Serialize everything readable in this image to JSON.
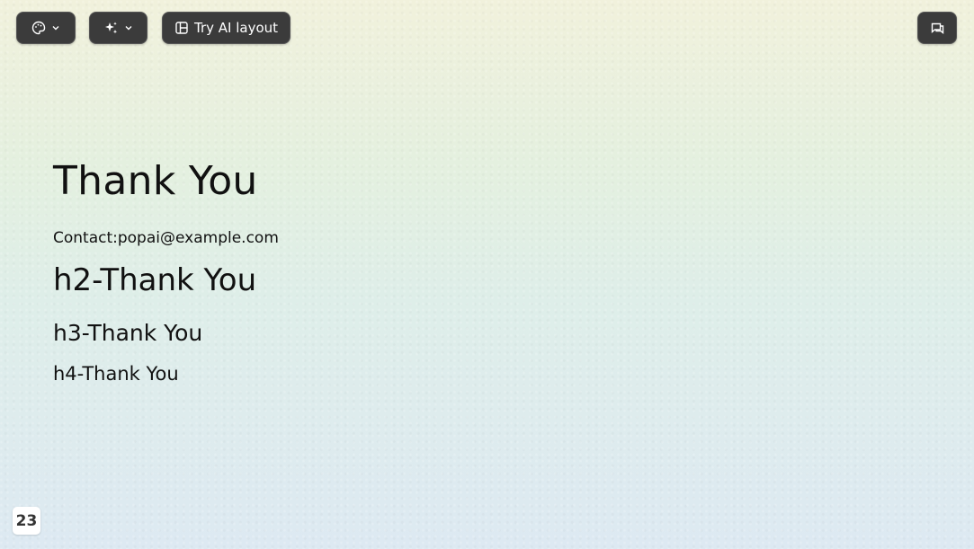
{
  "toolbar": {
    "theme_icon": "palette-icon",
    "ai_icon": "sparkles-icon",
    "layout_icon": "layout-icon",
    "layout_label": "Try AI layout",
    "comments_icon": "comments-icon",
    "dropdown_icon": "chevron-down-icon"
  },
  "slide": {
    "title": "Thank You",
    "contact": "Contact:popai@example.com",
    "h2": "h2-Thank You",
    "h3": "h3-Thank You",
    "h4": "h4-Thank You"
  },
  "page_number": "23",
  "colors": {
    "toolbar_bg": "#3b3b3b",
    "text": "#111111"
  }
}
